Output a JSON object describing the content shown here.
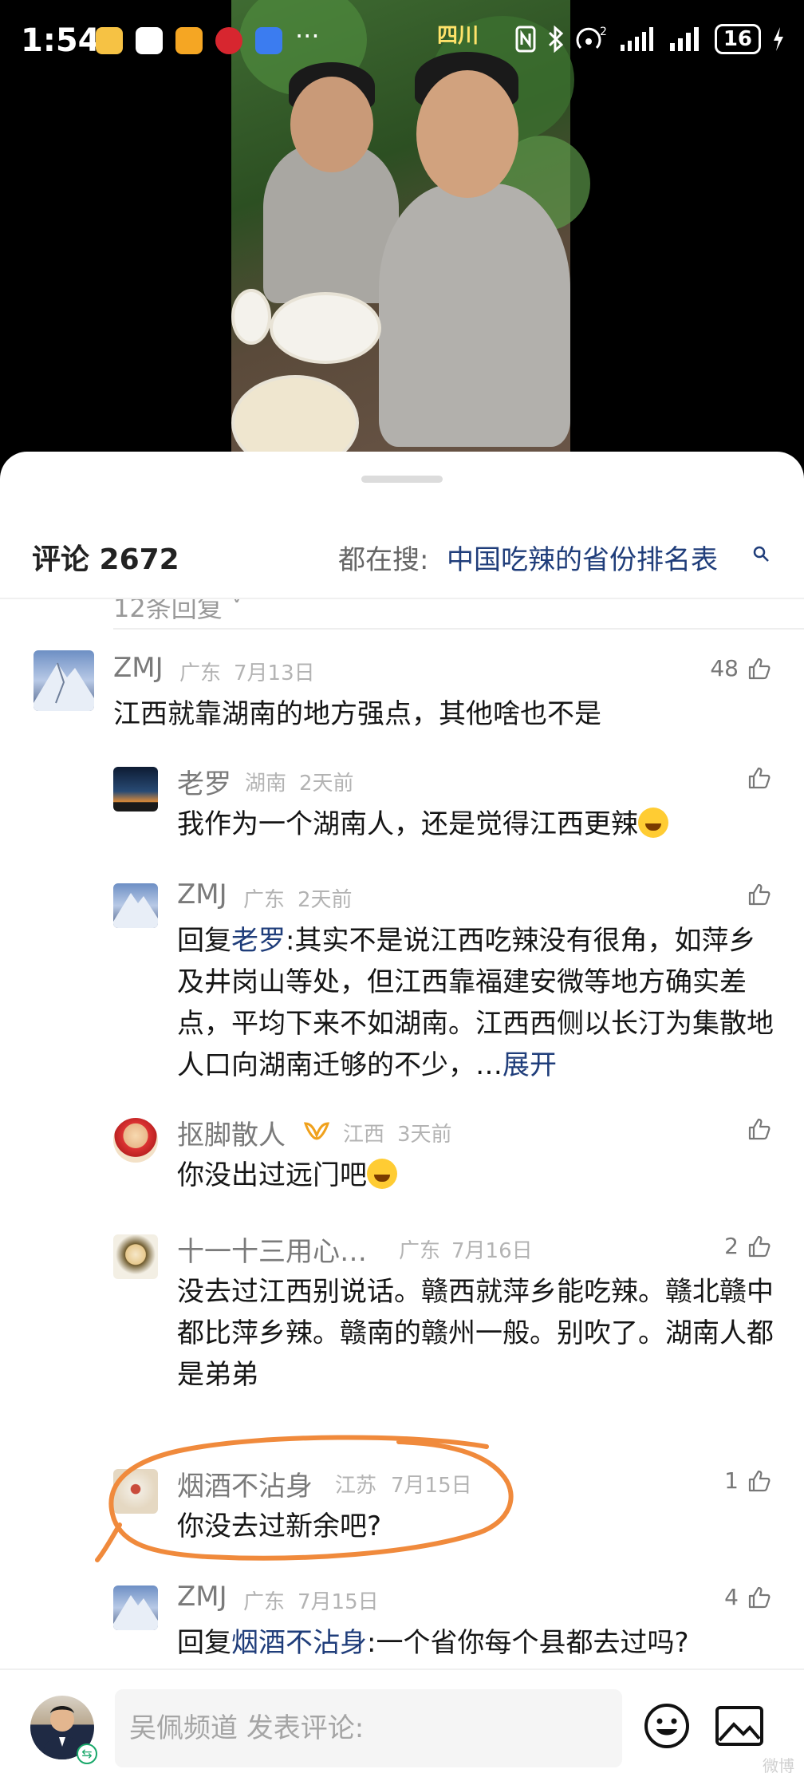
{
  "status_bar": {
    "time": "1:54",
    "more": "···",
    "location": "四川",
    "signal_extra": "2",
    "battery": "16"
  },
  "header": {
    "comment_label": "评论 2672",
    "search_prefix": "都在搜:",
    "search_query": "中国吃辣的省份排名表"
  },
  "collapsed_replies": "12条回复 ˅",
  "comments": [
    {
      "name": "ZMJ",
      "location": "广东",
      "time": "7月13日",
      "likes": "48",
      "text": "江西就靠湖南的地方强点，其他啥也不是"
    },
    {
      "name": "老罗",
      "location": "湖南",
      "time": "2天前",
      "likes": "",
      "text": "我作为一个湖南人，还是觉得江西更辣"
    },
    {
      "name": "ZMJ",
      "location": "广东",
      "time": "2天前",
      "likes": "",
      "reply_prefix": "回复",
      "reply_to": "老罗",
      "text": ":其实不是说江西吃辣没有很角，如萍乡及井岗山等处，但江西靠福建安微等地方确实差点，平均下来不如湖南。江西西侧以长汀为集散地人口向湖南迁够的不少，…",
      "expand": "展开"
    },
    {
      "name": "抠脚散人",
      "location": "江西",
      "time": "3天前",
      "likes": "",
      "text": "你没出过远门吧"
    },
    {
      "name": "十一十三用心…",
      "location": "广东",
      "time": "7月16日",
      "likes": "2",
      "text": "没去过江西别说话。赣西就萍乡能吃辣。赣北赣中都比萍乡辣。赣南的赣州一般。别吹了。湖南人都是弟弟"
    },
    {
      "name": "烟酒不沾身",
      "location": "江苏",
      "time": "7月15日",
      "likes": "1",
      "text": "你没去过新余吧?"
    },
    {
      "name": "ZMJ",
      "location": "广东",
      "time": "7月15日",
      "likes": "4",
      "reply_prefix": "回复",
      "reply_to": "烟酒不沾身",
      "text": ":一个省你每个县都去过吗?"
    }
  ],
  "bottom_bar": {
    "input_placeholder": "吴佩频道 发表评论:",
    "watermark": "微博"
  },
  "colors": {
    "accent_link": "#1f3d7a",
    "annotation": "#f08a3c"
  }
}
